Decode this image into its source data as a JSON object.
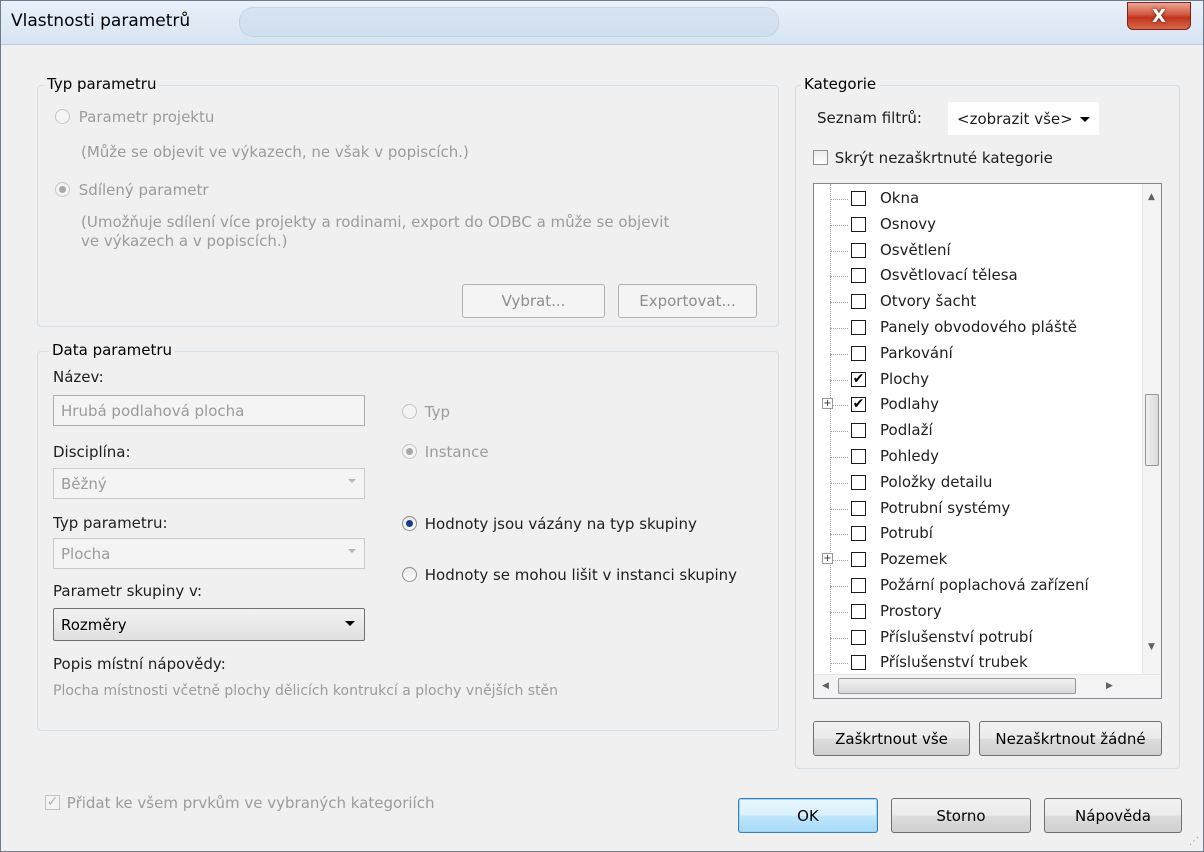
{
  "window": {
    "title": "Vlastnosti parametrů",
    "close_label": "X"
  },
  "parameter_type": {
    "legend": "Typ parametru",
    "project_label": "Parametr projektu",
    "project_desc": "(Může se objevit ve výkazech, ne však v popiscích.)",
    "shared_label": "Sdílený parametr",
    "shared_desc_1": "(Umožňuje sdílení více projekty a rodinami, export do ODBC a může se objevit",
    "shared_desc_2": "ve výkazech a v popiscích.)",
    "select_button": "Vybrat...",
    "export_button": "Exportovat..."
  },
  "parameter_data": {
    "legend": "Data parametru",
    "name_label": "Název:",
    "name_value": "Hrubá podlahová plocha",
    "discipline_label": "Disciplína:",
    "discipline_value": "Běžný",
    "type_label": "Typ parametru:",
    "type_value": "Plocha",
    "group_label": "Parametr skupiny v:",
    "group_value": "Rozměry",
    "help_label": "Popis místní nápovědy:",
    "help_text": "Plocha místnosti včetně plochy dělicích kontrukcí a plochy vnějších stěn",
    "radio_type": "Typ",
    "radio_instance": "Instance",
    "radio_group_type": "Hodnoty jsou vázány na typ skupiny",
    "radio_group_instance": "Hodnoty se mohou lišit v instanci skupiny"
  },
  "categories": {
    "legend": "Kategorie",
    "filter_label": "Seznam filtrů:",
    "filter_value": "<zobrazit vše>",
    "hide_unchecked": "Skrýt nezaškrtnuté kategorie",
    "items": [
      {
        "label": "Okna",
        "checked": false,
        "expandable": false
      },
      {
        "label": "Osnovy",
        "checked": false,
        "expandable": false
      },
      {
        "label": "Osvětlení",
        "checked": false,
        "expandable": false
      },
      {
        "label": "Osvětlovací tělesa",
        "checked": false,
        "expandable": false
      },
      {
        "label": "Otvory šacht",
        "checked": false,
        "expandable": false
      },
      {
        "label": "Panely obvodového pláště",
        "checked": false,
        "expandable": false
      },
      {
        "label": "Parkování",
        "checked": false,
        "expandable": false
      },
      {
        "label": "Plochy",
        "checked": true,
        "expandable": false
      },
      {
        "label": "Podlahy",
        "checked": true,
        "expandable": true
      },
      {
        "label": "Podlaží",
        "checked": false,
        "expandable": false
      },
      {
        "label": "Pohledy",
        "checked": false,
        "expandable": false
      },
      {
        "label": "Položky detailu",
        "checked": false,
        "expandable": false
      },
      {
        "label": "Potrubní systémy",
        "checked": false,
        "expandable": false
      },
      {
        "label": "Potrubí",
        "checked": false,
        "expandable": false
      },
      {
        "label": "Pozemek",
        "checked": false,
        "expandable": true
      },
      {
        "label": "Požární poplachová zařízení",
        "checked": false,
        "expandable": false
      },
      {
        "label": "Prostory",
        "checked": false,
        "expandable": false
      },
      {
        "label": "Příslušenství potrubí",
        "checked": false,
        "expandable": false
      },
      {
        "label": "Příslušenství trubek",
        "checked": false,
        "expandable": false
      }
    ],
    "check_all": "Zaškrtnout vše",
    "uncheck_all": "Nezaškrtnout žádné"
  },
  "footer": {
    "add_to_all": "Přidat ke všem prvkům ve vybraných kategoriích",
    "ok": "OK",
    "cancel": "Storno",
    "help": "Nápověda"
  }
}
